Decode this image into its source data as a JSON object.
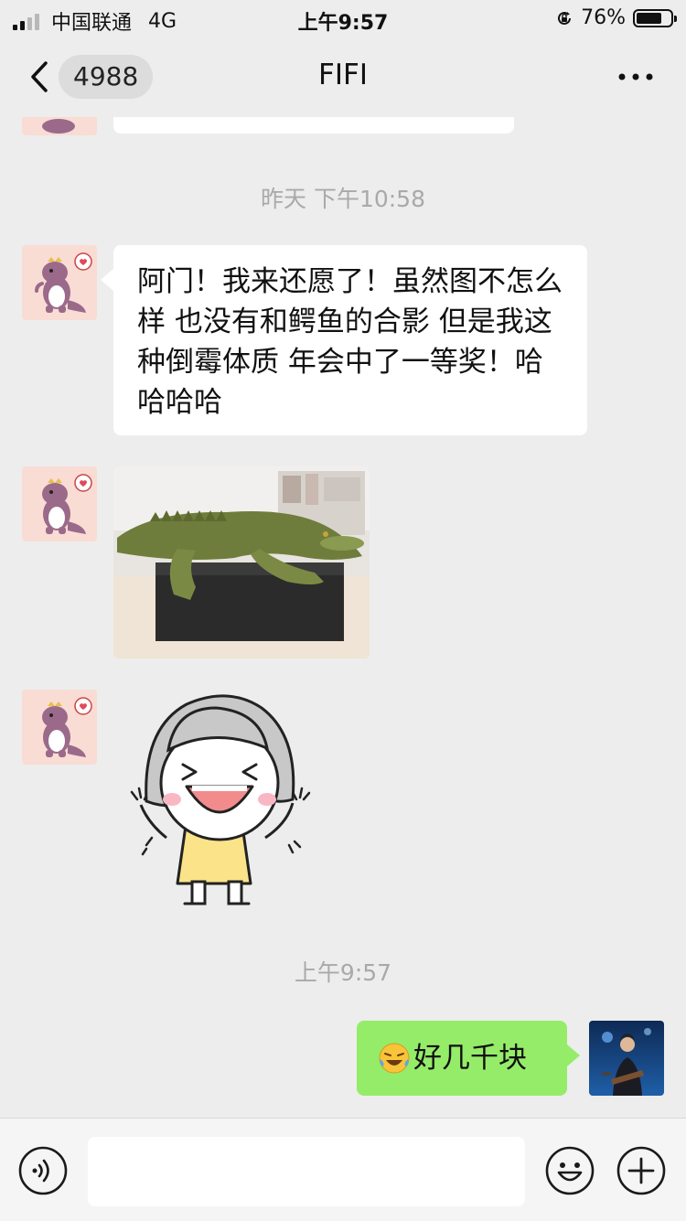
{
  "status_bar": {
    "carrier": "中国联通",
    "network": "4G",
    "time": "上午9:57",
    "battery_percent": "76%",
    "battery_level": 0.76
  },
  "nav": {
    "unread_count": "4988",
    "title": "FIFI"
  },
  "messages": {
    "timestamp_1": "昨天 下午10:58",
    "text_1": "阿门！我来还愿了！虽然图不怎么样 也没有和鳄鱼的合影 但是我这种倒霉体质 年会中了一等奖！哈哈哈哈",
    "timestamp_2": "上午9:57",
    "my_text": "好几千块"
  },
  "input_bar": {
    "placeholder": ""
  },
  "colors": {
    "background": "#ededed",
    "my_bubble": "#95ec69",
    "their_bubble": "#ffffff",
    "timestamp": "#a9a9a9",
    "avatar_bg": "#f9dcd4"
  },
  "icons": [
    "signal-icon",
    "lock-rotation-icon",
    "battery-icon",
    "back-chevron-icon",
    "more-dots-icon",
    "voice-icon",
    "emoji-icon",
    "plus-icon",
    "crying-laughing-emoji-icon"
  ]
}
